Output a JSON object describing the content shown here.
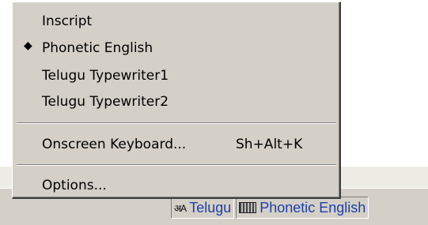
{
  "menu": {
    "items": [
      {
        "label": "Inscript",
        "checked": false
      },
      {
        "label": "Phonetic English",
        "checked": true,
        "bullet": "◆"
      },
      {
        "label": "Telugu Typewriter1",
        "checked": false
      },
      {
        "label": "Telugu Typewriter2",
        "checked": false
      }
    ],
    "onscreen_keyboard": {
      "label": "Onscreen Keyboard...",
      "shortcut": "Sh+Alt+K"
    },
    "options": {
      "label": "Options..."
    }
  },
  "language_bar": {
    "language_glyph": "अA",
    "language_label": "Telugu",
    "layout_label": "Phonetic English",
    "accent_color": "#1e3fa8",
    "icons": [
      "language-icon",
      "keyboard-icon"
    ]
  }
}
